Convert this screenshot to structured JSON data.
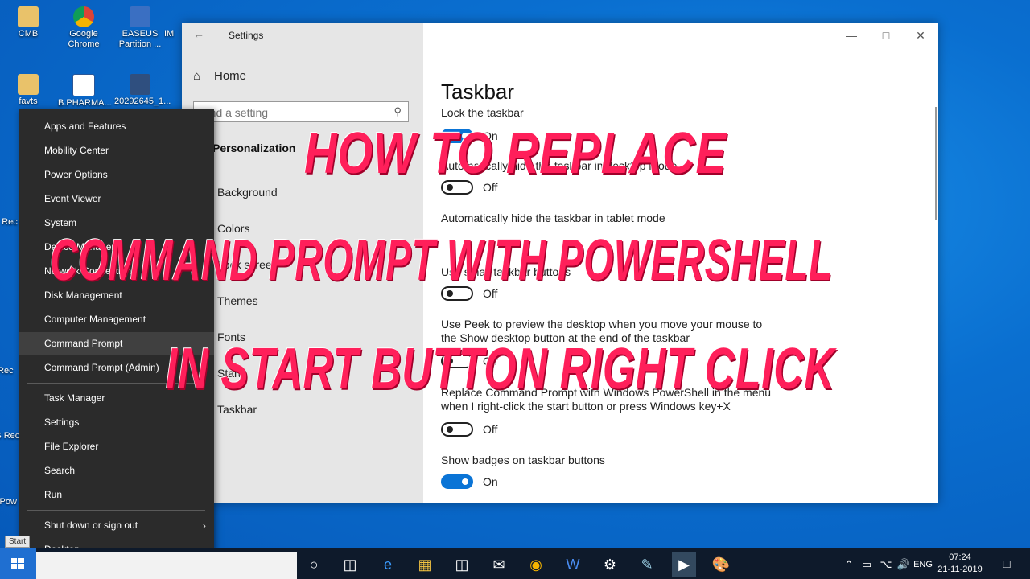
{
  "desktop_icons": [
    {
      "label": "CMB"
    },
    {
      "label": "Google Chrome"
    },
    {
      "label": "EASEUS Partition ..."
    },
    {
      "label": "IM"
    },
    {
      "label": "favts"
    },
    {
      "label": "B.PHARMA..."
    },
    {
      "label": "20292645_1..."
    },
    {
      "label": "Rec"
    },
    {
      "label": "A Rec"
    },
    {
      "label": "EAS Rec"
    },
    {
      "label": "Cy Pow"
    }
  ],
  "settings": {
    "window_title": "Settings",
    "home": "Home",
    "search_placeholder": "Find a setting",
    "section": "Personalization",
    "nav": [
      "Background",
      "Colors",
      "Lock screen",
      "Themes",
      "Fonts",
      "Start",
      "Taskbar"
    ],
    "page_title": "Taskbar",
    "items": [
      {
        "label": "Lock the taskbar",
        "state": "On"
      },
      {
        "label": "Automatically hide the taskbar in desktop mode",
        "state": "Off"
      },
      {
        "label": "Automatically hide the taskbar in tablet mode",
        "state": ""
      },
      {
        "label": "Use small taskbar buttons",
        "state": "Off"
      },
      {
        "label": "Use Peek to preview the desktop when you move your mouse to the Show desktop button at the end of the taskbar",
        "state": "Off"
      },
      {
        "label": "Replace Command Prompt with Windows PowerShell in the menu when I right-click the start button or press Windows key+X",
        "state": "Off"
      },
      {
        "label": "Show badges on taskbar buttons",
        "state": "On"
      }
    ]
  },
  "winx_menu": {
    "items": [
      "Apps and Features",
      "Mobility Center",
      "Power Options",
      "Event Viewer",
      "System",
      "Device Manager",
      "Network Connections",
      "Disk Management",
      "Computer Management",
      "Command Prompt",
      "Command Prompt (Admin)",
      "Task Manager",
      "Settings",
      "File Explorer",
      "Search",
      "Run",
      "Shut down or sign out",
      "Desktop"
    ],
    "highlighted": "Command Prompt"
  },
  "overlay": {
    "line1": "HOW TO REPLACE",
    "line2": "COMMAND PROMPT WITH POWERSHELL",
    "line3": "IN START BUTTON RIGHT CLICK",
    "color": "#ff1f5a"
  },
  "taskbar": {
    "start_tooltip": "Start",
    "language": "ENG",
    "time": "07:24",
    "date": "21-11-2019",
    "icons": [
      "task-view-icon",
      "edge-icon",
      "file-explorer-icon",
      "store-icon",
      "mail-icon",
      "chrome-icon",
      "word-icon",
      "settings-icon",
      "notepad-icon",
      "cmd-icon",
      "paint-icon"
    ]
  }
}
